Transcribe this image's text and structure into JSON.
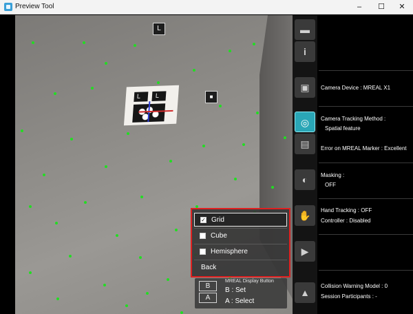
{
  "window": {
    "title": "Preview Tool",
    "minimize_glyph": "–",
    "maximize_glyph": "☐",
    "close_glyph": "✕"
  },
  "viewport": {
    "marker_labels": {
      "left": "L",
      "right": "L"
    },
    "overlay_buttons": {
      "top_label": "L",
      "square_glyph": "■"
    }
  },
  "panel": {
    "icons": [
      "headset-icon",
      "info-icon",
      "camera-device-icon",
      "camera-tracking-icon",
      "marker-error-icon",
      "masking-icon",
      "hand-tracking-icon",
      "video-camera-icon",
      "collision-warning-icon"
    ],
    "icon_glyphs": {
      "info": "i",
      "hand": "✋",
      "video": "▶",
      "warning": "▲"
    },
    "camera_device": "Camera Device : MREAL X1",
    "camera_tracking_method_label": "Camera Tracking Method :",
    "camera_tracking_method_value": "Spatial feature",
    "marker_error": "Error on MREAL Marker : Excellent",
    "masking_label": "Masking :",
    "masking_value": "OFF",
    "hand_tracking": "Hand Tracking : OFF",
    "controller": "Controller : Disabled",
    "collision_warning_model": "Collision Warning Model : 0",
    "session_participants": "Session Participants : -"
  },
  "menu": {
    "items": [
      {
        "label": "Grid",
        "checked": true
      },
      {
        "label": "Cube",
        "checked": false
      },
      {
        "label": "Hemisphere",
        "checked": false
      },
      {
        "label": "Back"
      }
    ],
    "check_glyph": "✓",
    "highlight_color": "#e02020"
  },
  "display_button": {
    "title": "MREAL Display Button",
    "b_key": "B",
    "a_key": "A",
    "b_action": "B : Set",
    "a_action": "A : Select"
  },
  "colors": {
    "accent_active": "#2aa6b6",
    "grid_dots": "#22dd22",
    "selection_border": "#e02020"
  }
}
